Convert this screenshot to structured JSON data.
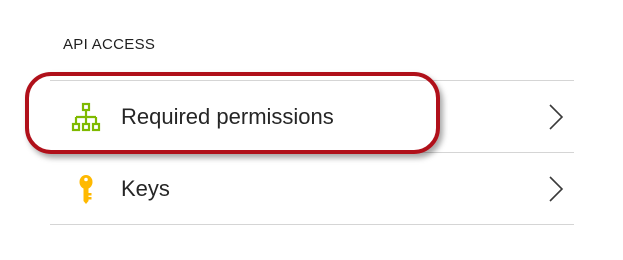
{
  "section": {
    "title": "API ACCESS"
  },
  "items": [
    {
      "label": "Required permissions",
      "icon": "hierarchy-network-icon",
      "icon_color": "#7fba00"
    },
    {
      "label": "Keys",
      "icon": "key-icon",
      "icon_color": "#ffb900"
    }
  ],
  "colors": {
    "highlight": "#b0101a",
    "divider": "#d5d5d5"
  }
}
